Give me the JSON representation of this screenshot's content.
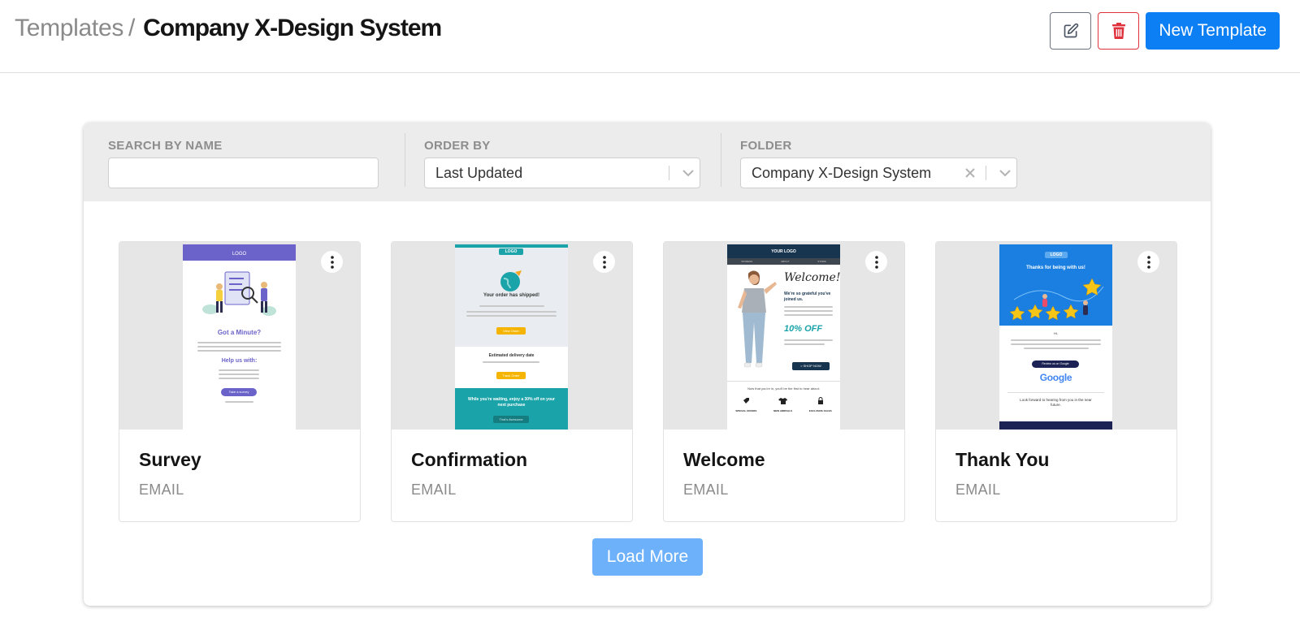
{
  "breadcrumb": {
    "parent": "Templates",
    "separator": "/",
    "current": "Company X-Design System"
  },
  "header_actions": {
    "new_template_label": "New Template"
  },
  "filters": {
    "search": {
      "label": "SEARCH BY NAME",
      "value": ""
    },
    "order_by": {
      "label": "ORDER BY",
      "value": "Last Updated"
    },
    "folder": {
      "label": "FOLDER",
      "value": "Company X-Design System"
    }
  },
  "templates": [
    {
      "name": "Survey",
      "type": "EMAIL",
      "preview": {
        "logo": "LOGO",
        "heading": "Got a Minute?",
        "subheading": "Help us with:",
        "button": "Take a survey",
        "accent": "#6b63c9"
      }
    },
    {
      "name": "Confirmation",
      "type": "EMAIL",
      "preview": {
        "logo": "LOGO",
        "heading": "Your order has shipped!",
        "subheading": "Estimated delivery date",
        "button_1": "View Order",
        "button_2": "Track Order",
        "banner": "While you're waiting, enjoy a 30% off on your next purchase",
        "button_3": "That's Awesome",
        "accent": "#1aa3a8"
      }
    },
    {
      "name": "Welcome",
      "type": "EMAIL",
      "preview": {
        "logo": "YOUR LOGO",
        "nav": [
          "WOMENS",
          "ABOUT",
          "STORE"
        ],
        "heading": "Welcome!",
        "tagline": "We're so grateful you've joined us.",
        "offer": "10% OFF",
        "button": "> SHOP NOW",
        "footer": "Now that you're in, you'll be the first to hear about:",
        "features": [
          "SPECIAL OFFERS",
          "NEW ARRIVALS",
          "EXCLUSIVE SALES"
        ],
        "accent": "#17354f"
      }
    },
    {
      "name": "Thank You",
      "type": "EMAIL",
      "preview": {
        "logo": "LOGO",
        "heading": "Thanks for being with us!",
        "button": "Review us on Google",
        "brand": "Google",
        "closing": "Look forward to hearing from you in the near future.",
        "accent": "#1a7fe0"
      }
    }
  ],
  "load_more_label": "Load More",
  "colors": {
    "primary": "#0d7ff5",
    "danger": "#e0323c",
    "load_more": "#6eb1fb"
  }
}
